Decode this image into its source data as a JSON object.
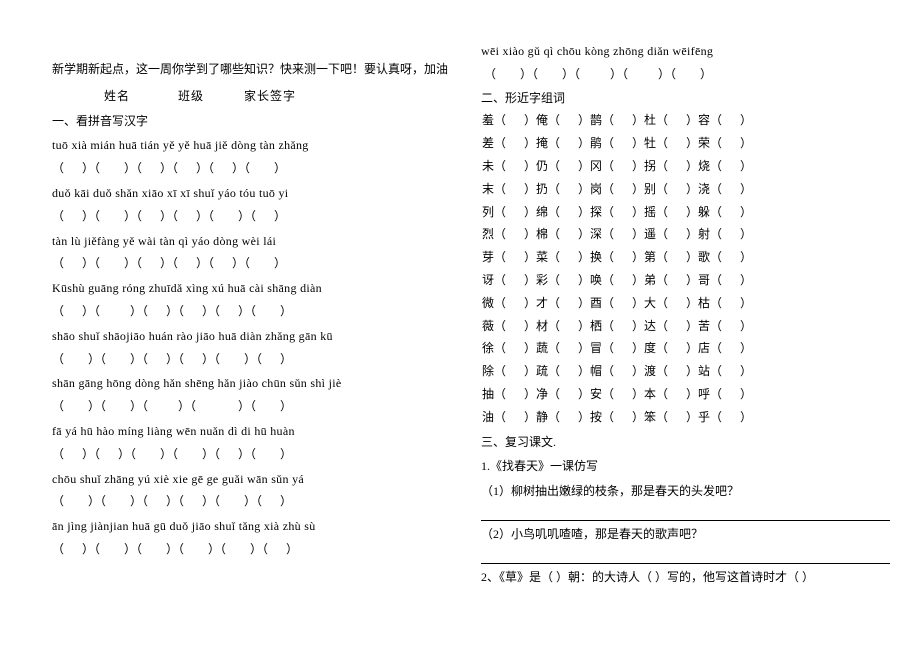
{
  "left": {
    "intro": "新学期新起点，这一周你学到了哪些知识？快来测一下吧！要认真呀，加油",
    "info_name": "姓名",
    "info_class": "班级",
    "info_sign": "家长签字",
    "section1": "一、看拼音写汉字",
    "p1": "tuō xià   mián huā    tián yě   yě huā   jiě dòng   tàn zhǎng",
    "p2": "duǒ kāi  duǒ shǎn   xiāo xī    xī shuǐ    yáo tóu   tuō yi",
    "p3": "tàn lù   jiěfàng   yě wài   tàn qì   yáo dòng   wèi lái",
    "p4": "Kūshù    guāng róng   zhuīdǎ   xìng xú   huā cài   shāng diàn",
    "p5": "shāo shuǐ  shāojiāo   huán rào   jiāo huā   diàn zhǎng   gān kū",
    "p6": "shān gāng   hōng dòng   hǎn shēng hǎn  jiào chūn sǔn shì  jiè",
    "p7": "fā yá   hū hào   míng liàng   wēn nuǎn    dì di   hū huàn",
    "p8": "chōu shuǐ zhāng yú    xiè xie   gē ge    guǎi wān   sǔn yá",
    "p9": "ān jìng    jiànjian   huā gū duǒ   jiāo shuǐ   tǎng xià   zhù sù"
  },
  "right": {
    "p10": "wēi xiào   gǔ  qì   chōu kòng   zhōng diǎn   wēifēng",
    "section2": "二、形近字组词",
    "near": [
      [
        "羞（",
        "）俺（",
        "）鹊（",
        "）杜（",
        "）容（",
        "）"
      ],
      [
        "差（",
        "）掩（",
        "）鹃（",
        "）牡（",
        "）荣（",
        "）"
      ],
      [
        "未（",
        "）仍（",
        "）冈（",
        "）拐（",
        "）烧（",
        "）"
      ],
      [
        "末（",
        "）扔（",
        "）岗（",
        "）别（",
        "）浇（",
        "）"
      ],
      [
        "列（",
        "）绵（",
        "）探（",
        "）摇（",
        "）躲（",
        "）"
      ],
      [
        "烈（",
        "）棉（",
        "）深（",
        "）遥（",
        "）射（",
        "）"
      ],
      [
        "芽（",
        "）菜（",
        "）换（",
        "）第（",
        "）歌（",
        "）"
      ],
      [
        "讶（",
        "）彩（",
        "）唤（",
        "）弟（",
        "）哥（",
        "）"
      ],
      [
        "微（",
        "）才（",
        "）酉（",
        "）大（",
        "）枯（",
        "）"
      ],
      [
        "薇（",
        "）材（",
        "）栖（",
        "）达（",
        "）苦（",
        "）"
      ],
      [
        "徐（",
        "）蔬（",
        "）冒（",
        "）度（",
        "）店（",
        "）"
      ],
      [
        "除（",
        "）疏（",
        "）帽（",
        "）渡（",
        "）站（",
        "）"
      ],
      [
        "抽（",
        "）净（",
        "）安（",
        "）本（",
        "）呼（",
        "）"
      ],
      [
        "油（",
        "）静（",
        "）按（",
        "）笨（",
        "）乎（",
        "）"
      ]
    ],
    "section3": "三、复习课文.",
    "q1": "1.《找春天》一课仿写",
    "q1a": "（1）柳树抽出嫩绿的枝条，那是春天的头发吧？",
    "q1b": "（2）小鸟叽叽喳喳，那是春天的歌声吧？",
    "q2a": "2、《草》是（    ）朝：的大诗人（     ）写的，他写这首诗时才（    ）"
  }
}
